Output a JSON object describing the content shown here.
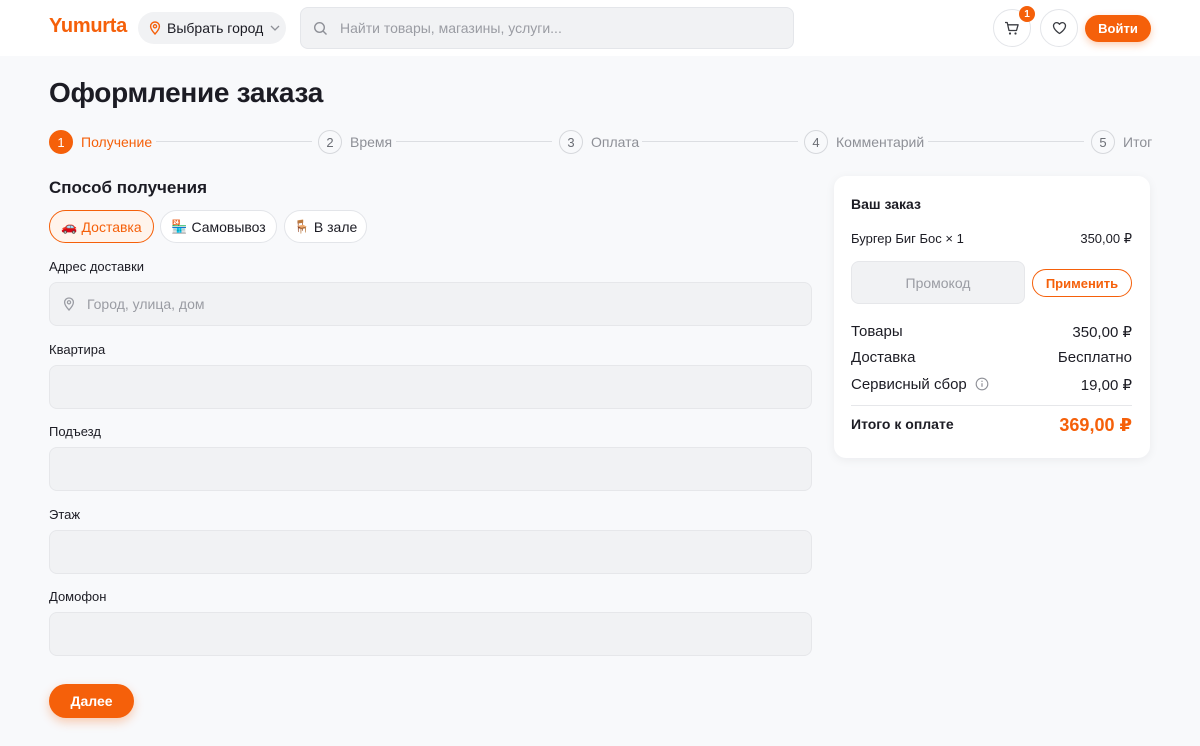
{
  "header": {
    "logo": "Yumurta",
    "city_button": "Выбрать город",
    "search_placeholder": "Найти товары, магазины, услуги...",
    "cart_count": "1",
    "login_button": "Войти"
  },
  "page": {
    "title": "Оформление заказа"
  },
  "steps": [
    {
      "number": "1",
      "label": "Получение",
      "active": true
    },
    {
      "number": "2",
      "label": "Время",
      "active": false
    },
    {
      "number": "3",
      "label": "Оплата",
      "active": false
    },
    {
      "number": "4",
      "label": "Комментарий",
      "active": false
    },
    {
      "number": "5",
      "label": "Итог",
      "active": false
    }
  ],
  "receipt": {
    "section_title": "Способ получения",
    "methods": [
      {
        "icon": "🚗",
        "label": "Доставка",
        "selected": true
      },
      {
        "icon": "🏪",
        "label": "Самовывоз",
        "selected": false
      },
      {
        "icon": "🪑",
        "label": "В зале",
        "selected": false
      }
    ]
  },
  "form": {
    "address_label": "Адрес доставки",
    "address_placeholder": "Город, улица, дом",
    "address_value": "",
    "apartment_label": "Квартира",
    "apartment_value": "",
    "entrance_label": "Подъезд",
    "entrance_value": "",
    "floor_label": "Этаж",
    "floor_value": "",
    "intercom_label": "Домофон",
    "intercom_value": "",
    "next_button": "Далее"
  },
  "summary": {
    "title": "Ваш заказ",
    "item_name": "Бургер Биг Бос × 1",
    "item_price": "350,00 ₽",
    "promo_placeholder": "Промокод",
    "promo_value": "",
    "apply_button": "Применить",
    "goods_label": "Товары",
    "goods_value": "350,00 ₽",
    "delivery_label": "Доставка",
    "delivery_value": "Бесплатно",
    "service_label": "Сервисный сбор",
    "service_value": "19,00 ₽",
    "total_label": "Итого к оплате",
    "total_value": "369,00 ₽"
  },
  "colors": {
    "accent": "#f5600a",
    "background": "#f8f9fb",
    "text": "#1c1c24"
  },
  "icons": {
    "city": "map-pin-icon",
    "search": "search-icon",
    "cart": "cart-icon",
    "favorites": "heart-icon",
    "address": "map-pin-icon",
    "service_fee": "info-icon"
  }
}
